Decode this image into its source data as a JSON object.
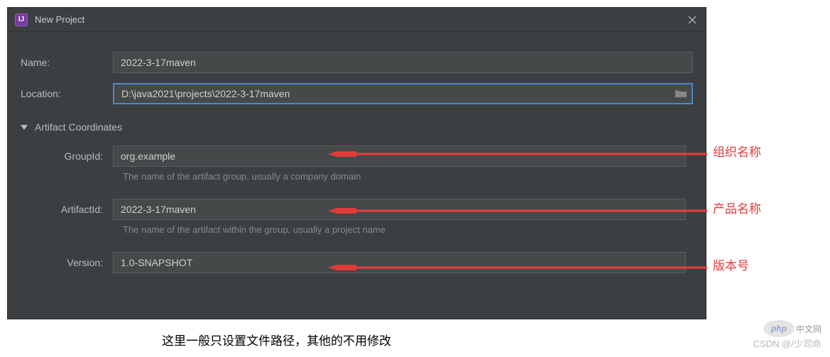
{
  "window": {
    "title": "New Project"
  },
  "form": {
    "name_label": "Name:",
    "name_value": "2022-3-17maven",
    "location_label": "Location:",
    "location_value": "D:\\java2021\\projects\\2022-3-17maven"
  },
  "section": {
    "title": "Artifact Coordinates"
  },
  "artifact": {
    "groupid_label": "GroupId:",
    "groupid_value": "org.example",
    "groupid_hint": "The name of the artifact group, usually a company domain",
    "artifactid_label": "ArtifactId:",
    "artifactid_value": "2022-3-17maven",
    "artifactid_hint": "The name of the artifact within the group, usually a project name",
    "version_label": "Version:",
    "version_value": "1.0-SNAPSHOT"
  },
  "annotations": {
    "groupid": "组织名称",
    "artifactid": "产品名称",
    "version": "版本号"
  },
  "footer": "这里一般只设置文件路径，其他的不用修改",
  "watermark": {
    "csdn": "CSDN @/少司命",
    "php": "php",
    "php_cn": "中文网"
  }
}
